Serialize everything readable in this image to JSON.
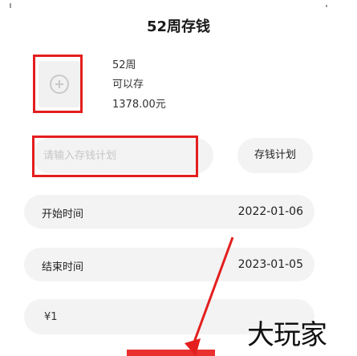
{
  "header": {
    "title": "52周存钱"
  },
  "plan_info": {
    "weeks": "52周",
    "status": "可以存",
    "amount": "1378.00元"
  },
  "form": {
    "input_placeholder": "请输入存钱计划",
    "plan_button_label": "存钱计划",
    "start": {
      "label": "开始时间",
      "value": "2022-01-06"
    },
    "end": {
      "label": "结束时间",
      "value": "2023-01-05"
    },
    "amount_value": "¥1"
  },
  "watermark": "大玩家",
  "colors": {
    "annotation_red": "#e41e1e",
    "pill_bg": "#f3f3f3"
  },
  "icons": {
    "photo_placeholder": "plus-circle-icon"
  }
}
